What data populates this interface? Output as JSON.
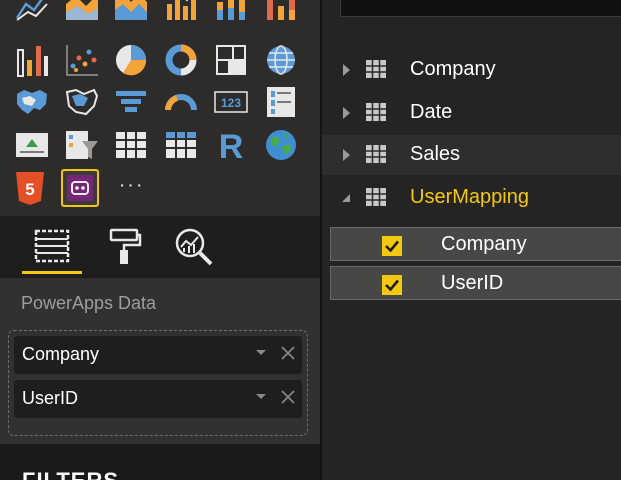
{
  "visualizations": [
    {
      "icon": "line-chart-icon"
    },
    {
      "icon": "area-chart-icon"
    },
    {
      "icon": "stacked-area-chart-icon"
    },
    {
      "icon": "line-clustered-column-chart-icon"
    },
    {
      "icon": "line-stacked-column-chart-icon"
    },
    {
      "icon": "ribbon-chart-icon"
    },
    {
      "icon": "waterfall-chart-icon"
    },
    {
      "icon": "scatter-chart-icon"
    },
    {
      "icon": "pie-chart-icon"
    },
    {
      "icon": "donut-chart-icon"
    },
    {
      "icon": "treemap-icon"
    },
    {
      "icon": "map-globe-icon"
    },
    {
      "icon": "filled-map-icon"
    },
    {
      "icon": "shape-map-icon"
    },
    {
      "icon": "funnel-icon"
    },
    {
      "icon": "gauge-icon"
    },
    {
      "icon": "card-icon",
      "label": "123"
    },
    {
      "icon": "multi-row-card-icon"
    },
    {
      "icon": "kpi-icon"
    },
    {
      "icon": "slicer-icon"
    },
    {
      "icon": "table-icon"
    },
    {
      "icon": "matrix-icon"
    },
    {
      "icon": "r-script-icon",
      "label": "R"
    },
    {
      "icon": "arcgis-map-icon"
    },
    {
      "icon": "html5-icon",
      "label": "5"
    },
    {
      "icon": "powerapps-icon"
    },
    {
      "icon": "more-icon",
      "label": "· · ·"
    }
  ],
  "pane_tabs": [
    {
      "icon": "fields-icon"
    },
    {
      "icon": "format-paint-roller-icon"
    },
    {
      "icon": "analytics-magnifier-icon"
    }
  ],
  "fields_section": {
    "title": "PowerApps Data",
    "wells": [
      {
        "label": "Company"
      },
      {
        "label": "UserID"
      }
    ]
  },
  "filters": {
    "title": "FILTERS"
  },
  "fields_list": [
    {
      "name": "Company",
      "expanded": false
    },
    {
      "name": "Date",
      "expanded": false
    },
    {
      "name": "Sales",
      "expanded": false
    },
    {
      "name": "UserMapping",
      "expanded": true,
      "children": [
        {
          "name": "Company",
          "checked": true
        },
        {
          "name": "UserID",
          "checked": true
        }
      ]
    }
  ],
  "colors": {
    "accent": "#f2c811",
    "panel": "#2d2c2b",
    "background": "#252423",
    "text": "#ffffff",
    "muted_text": "#9e9d9c"
  }
}
